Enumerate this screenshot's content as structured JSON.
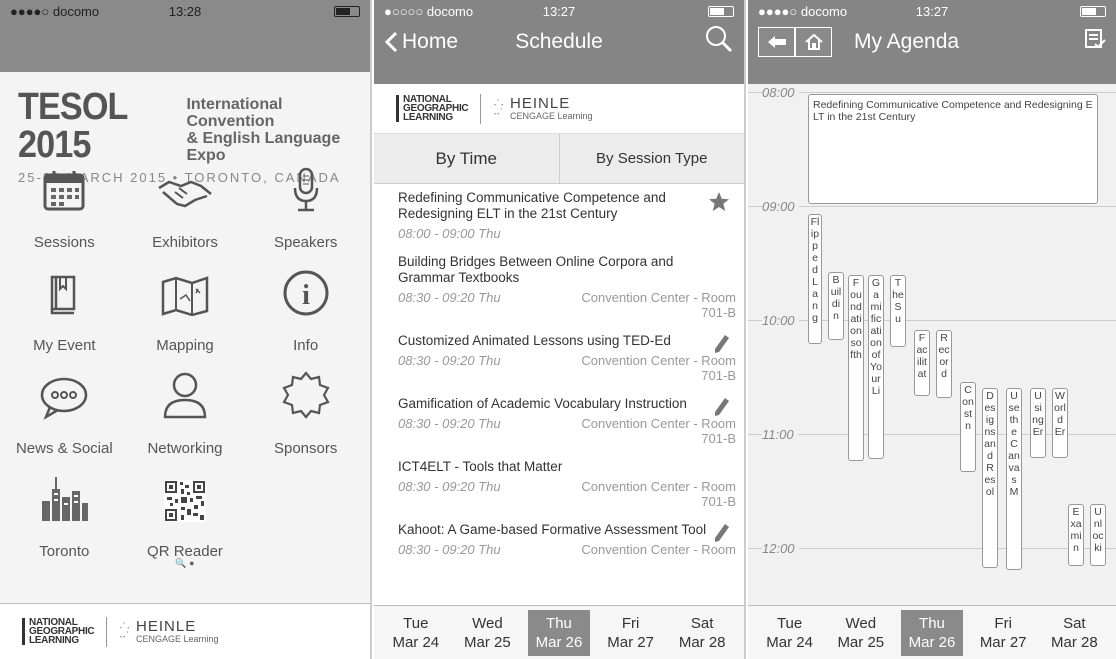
{
  "screen1": {
    "status": {
      "carrier": "●●●●○ docomo",
      "time": "13:28"
    },
    "banner": {
      "title": "TESOL 2015",
      "sub1": "International Convention",
      "sub2": "& English Language Expo",
      "dates": "25-28 MARCH 2015 • TORONTO, CANADA"
    },
    "tiles": [
      {
        "label": "Sessions",
        "icon": "calendar-icon"
      },
      {
        "label": "Exhibitors",
        "icon": "handshake-icon"
      },
      {
        "label": "Speakers",
        "icon": "microphone-icon"
      },
      {
        "label": "My Event",
        "icon": "book-icon"
      },
      {
        "label": "Mapping",
        "icon": "map-icon"
      },
      {
        "label": "Info",
        "icon": "info-icon"
      },
      {
        "label": "News & Social",
        "icon": "chat-bubble-icon"
      },
      {
        "label": "Networking",
        "icon": "person-icon"
      },
      {
        "label": "Sponsors",
        "icon": "badge-icon"
      },
      {
        "label": "Toronto",
        "icon": "city-icon"
      },
      {
        "label": "QR Reader",
        "icon": "qr-code-icon"
      }
    ],
    "pager": "🔍 ●",
    "footer": {
      "ngl": "NATIONAL\nGEOGRAPHIC\nLEARNING",
      "heinle": "HEINLE",
      "cengage": "CENGAGE Learning"
    }
  },
  "screen2": {
    "status": {
      "carrier": "●○○○○ docomo",
      "time": "13:27"
    },
    "nav": {
      "back": "Home",
      "title": "Schedule"
    },
    "logos": {
      "ngl": "NATIONAL\nGEOGRAPHIC\nLEARNING",
      "heinle": "HEINLE",
      "cengage": "CENGAGE Learning"
    },
    "segments": [
      "By Time",
      "By Session Type"
    ],
    "sessions": [
      {
        "title": "Redefining Communicative Competence and Redesigning ELT in the 21st Century",
        "time": "08:00 - 09:00 Thu",
        "loc": "",
        "icon": "star-icon"
      },
      {
        "title": "Building Bridges Between Online Corpora and Grammar Textbooks",
        "time": "08:30 - 09:20 Thu",
        "loc": "Convention Center - Room 701-B",
        "icon": ""
      },
      {
        "title": "Customized Animated Lessons using TED-Ed",
        "time": "08:30 - 09:20 Thu",
        "loc": "Convention Center - Room 701-B",
        "icon": "pencil-icon"
      },
      {
        "title": "Gamification of Academic Vocabulary Instruction",
        "time": "08:30 - 09:20 Thu",
        "loc": "Convention Center - Room 701-B",
        "icon": "pencil-icon"
      },
      {
        "title": "ICT4ELT - Tools that Matter",
        "time": "08:30 - 09:20 Thu",
        "loc": "Convention Center - Room 701-B",
        "icon": ""
      },
      {
        "title": "Kahoot: A Game-based Formative Assessment Tool",
        "time": "08:30 - 09:20 Thu",
        "loc": "Convention Center - Room",
        "icon": "pencil-icon"
      }
    ],
    "days": [
      {
        "d": "Tue",
        "date": "Mar 24"
      },
      {
        "d": "Wed",
        "date": "Mar 25"
      },
      {
        "d": "Thu",
        "date": "Mar 26",
        "selected": true
      },
      {
        "d": "Fri",
        "date": "Mar 27"
      },
      {
        "d": "Sat",
        "date": "Mar 28"
      }
    ]
  },
  "screen3": {
    "status": {
      "carrier": "●●●●○ docomo",
      "time": "13:27"
    },
    "nav": {
      "title": "My Agenda"
    },
    "hours": [
      "08:00",
      "09:00",
      "10:00",
      "11:00",
      "12:00"
    ],
    "events": [
      {
        "text": "Redefining Communicative Competence and Redesigning ELT in the 21st Century"
      },
      {
        "text": "FlippedLang"
      },
      {
        "text": "Buildin"
      },
      {
        "text": "Foundationsofth"
      },
      {
        "text": "GamificationofYourLi"
      },
      {
        "text": "TheSu"
      },
      {
        "text": "Facilitat"
      },
      {
        "text": "Record"
      },
      {
        "text": "Constn"
      },
      {
        "text": "DesignsandResol"
      },
      {
        "text": "UsetheCanvasM"
      },
      {
        "text": "UsingEr"
      },
      {
        "text": "WorldEr"
      },
      {
        "text": "Examin"
      },
      {
        "text": "Unlocki"
      }
    ],
    "days": [
      {
        "d": "Tue",
        "date": "Mar 24"
      },
      {
        "d": "Wed",
        "date": "Mar 25"
      },
      {
        "d": "Thu",
        "date": "Mar 26",
        "selected": true
      },
      {
        "d": "Fri",
        "date": "Mar 27"
      },
      {
        "d": "Sat",
        "date": "Mar 28"
      }
    ]
  }
}
